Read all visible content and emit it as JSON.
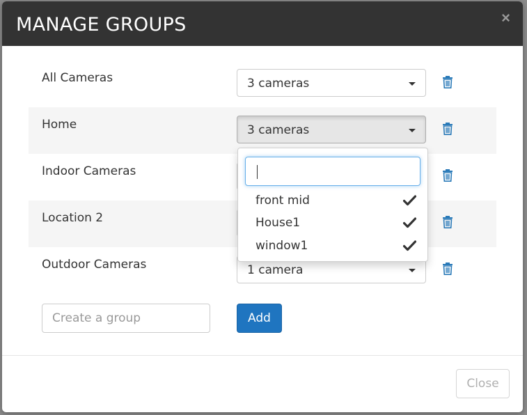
{
  "modal": {
    "title": "MANAGE GROUPS",
    "close_glyph": "×"
  },
  "groups": [
    {
      "name": "All Cameras",
      "selection": "3 cameras",
      "delete_icon": "trash-icon"
    },
    {
      "name": "Home",
      "selection": "3 cameras",
      "delete_icon": "trash-icon"
    },
    {
      "name": "Indoor Cameras",
      "selection": "",
      "delete_icon": "trash-icon"
    },
    {
      "name": "Location 2",
      "selection": "",
      "delete_icon": "trash-icon"
    },
    {
      "name": "Outdoor Cameras",
      "selection": "1 camera",
      "delete_icon": "trash-icon"
    }
  ],
  "dropdown": {
    "search_value": "",
    "items": [
      {
        "label": "front mid",
        "checked": true
      },
      {
        "label": "House1",
        "checked": true
      },
      {
        "label": "window1",
        "checked": true
      }
    ]
  },
  "create": {
    "placeholder": "Create a group",
    "add_label": "Add"
  },
  "footer": {
    "close_label": "Close"
  },
  "colors": {
    "header_bg": "#333333",
    "primary": "#1f75c0",
    "icon_blue": "#2a7ab8",
    "stripe": "#f5f5f5"
  }
}
